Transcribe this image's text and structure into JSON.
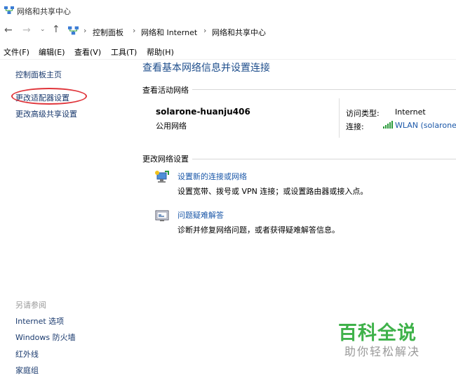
{
  "window": {
    "title": "网络和共享中心"
  },
  "address": {
    "crumbs": [
      "控制面板",
      "网络和 Internet",
      "网络和共享中心"
    ],
    "separator": "›"
  },
  "menu": [
    "文件(F)",
    "编辑(E)",
    "查看(V)",
    "工具(T)",
    "帮助(H)"
  ],
  "left_pane": {
    "links": [
      "控制面板主页",
      "更改适配器设置",
      "更改高级共享设置"
    ],
    "see_also_label": "另请参阅",
    "see_also": [
      "Internet 选项",
      "Windows 防火墙",
      "红外线",
      "家庭组"
    ]
  },
  "main": {
    "heading": "查看基本网络信息并设置连接",
    "active_label": "查看活动网络",
    "network": {
      "name": "solarone-huanju406",
      "type": "公用网络",
      "access_label": "访问类型:",
      "access_value": "Internet",
      "connection_label": "连接:",
      "connection_value": "WLAN (solarone"
    },
    "change_label": "更改网络设置",
    "tasks": [
      {
        "link": "设置新的连接或网络",
        "desc": "设置宽带、拨号或 VPN 连接；或设置路由器或接入点。",
        "icon": "network-setup-icon"
      },
      {
        "link": "问题疑难解答",
        "desc": "诊断并修复网络问题，或者获得疑难解答信息。",
        "icon": "troubleshoot-icon"
      }
    ]
  },
  "watermark": {
    "title": "百科全说",
    "subtitle": "助你轻松解决"
  },
  "colors": {
    "link": "#1a57a8",
    "heading": "#1e4e8c",
    "annotation": "#e0353b",
    "watermark": "#3fb24a"
  }
}
